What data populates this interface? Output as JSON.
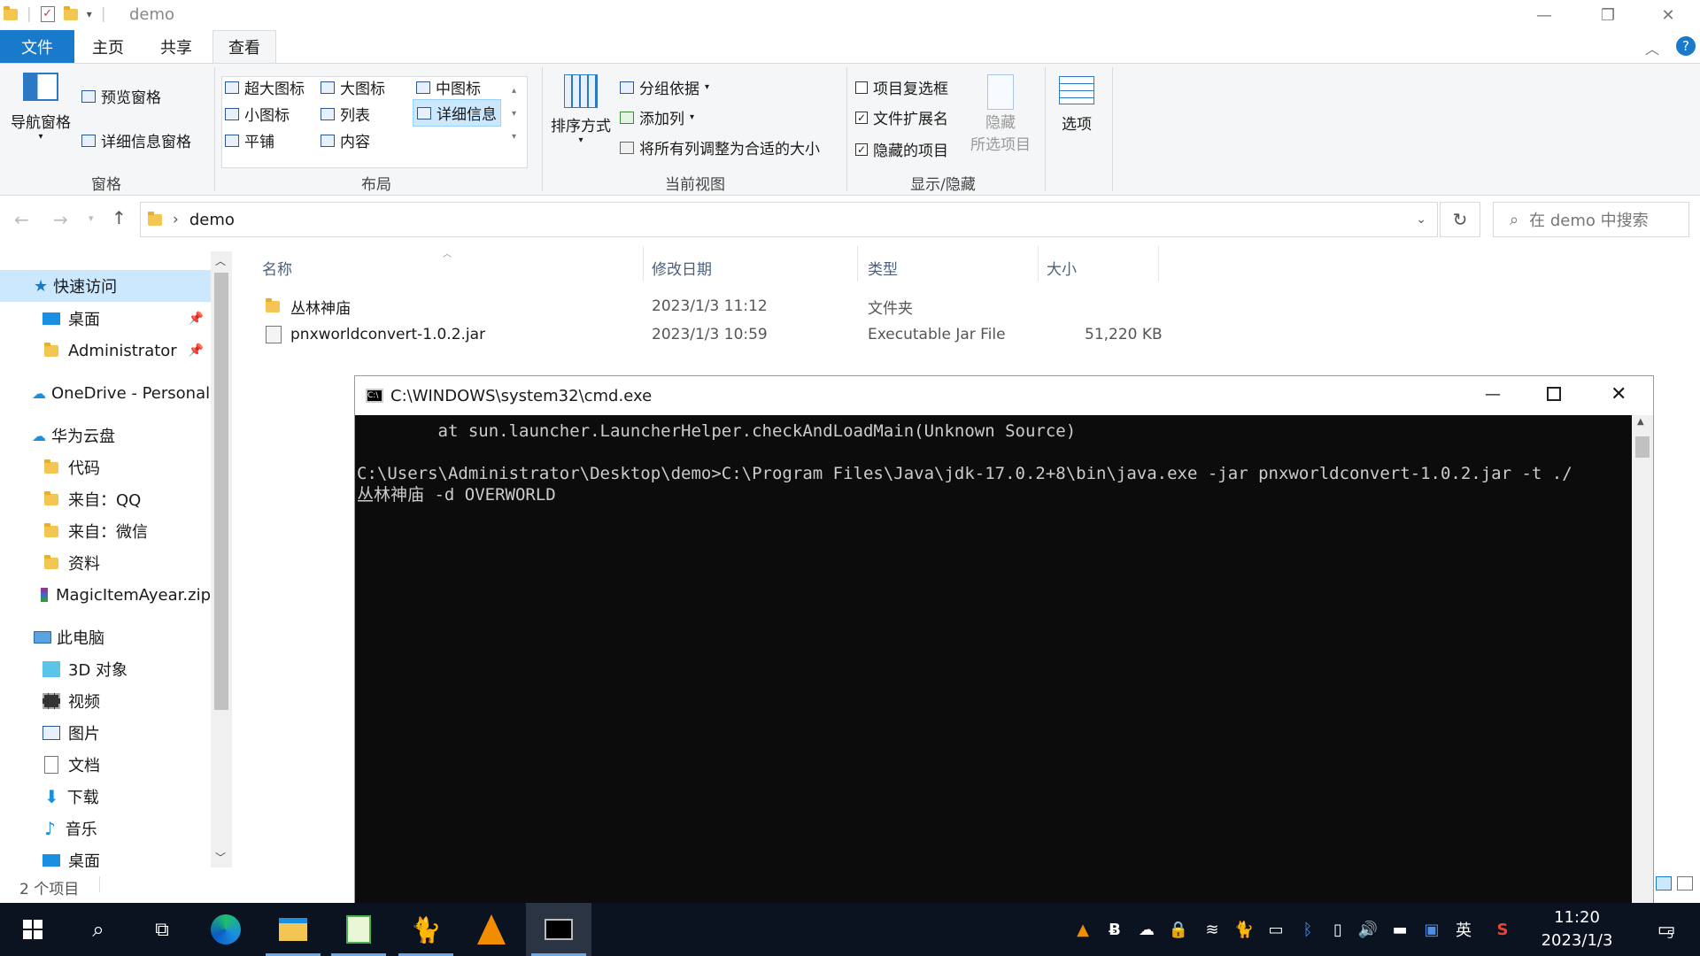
{
  "window": {
    "title": "demo"
  },
  "menu": {
    "file": "文件",
    "home": "主页",
    "share": "共享",
    "view": "查看"
  },
  "ribbon": {
    "pane_group": {
      "nav_pane": "导航窗格",
      "preview_pane": "预览窗格",
      "details_pane": "详细信息窗格",
      "label": "窗格"
    },
    "layout_group": {
      "xlarge": "超大图标",
      "large": "大图标",
      "medium": "中图标",
      "small": "小图标",
      "list": "列表",
      "details": "详细信息",
      "tiles": "平铺",
      "content": "内容",
      "label": "布局"
    },
    "view_group": {
      "sort": "排序方式",
      "group_by": "分组依据",
      "add_col": "添加列",
      "fit_cols": "将所有列调整为合适的大小",
      "label": "当前视图"
    },
    "showhide_group": {
      "item_checkboxes": "项目复选框",
      "file_ext": "文件扩展名",
      "hidden_items": "隐藏的项目",
      "hide_sel_1": "隐藏",
      "hide_sel_2": "所选项目",
      "label": "显示/隐藏"
    },
    "options": "选项",
    "checkboxes": {
      "item_checkboxes": false,
      "file_ext": true,
      "hidden_items": true
    }
  },
  "address": {
    "path": "demo",
    "search_placeholder": "在 demo 中搜索"
  },
  "nav": {
    "quick_access": "快速访问",
    "desktop_pinned": "桌面",
    "admin": "Administrator",
    "onedrive": "OneDrive - Personal",
    "huawei": "华为云盘",
    "code": "代码",
    "from_qq": "来自：QQ",
    "from_wechat": "来自：微信",
    "data": "资料",
    "magic": "MagicItemAyear.zip",
    "this_pc": "此电脑",
    "obj3d": "3D 对象",
    "video": "视频",
    "pictures": "图片",
    "documents": "文档",
    "downloads": "下载",
    "music": "音乐",
    "desktop": "桌面"
  },
  "columns": {
    "name": "名称",
    "modified": "修改日期",
    "type": "类型",
    "size": "大小"
  },
  "files": [
    {
      "name": "丛林神庙",
      "modified": "2023/1/3 11:12",
      "type": "文件夹",
      "size": ""
    },
    {
      "name": "pnxworldconvert-1.0.2.jar",
      "modified": "2023/1/3 10:59",
      "type": "Executable Jar File",
      "size": "51,220 KB"
    }
  ],
  "status": {
    "count": "2 个项目"
  },
  "cmd": {
    "title": "C:\\WINDOWS\\system32\\cmd.exe",
    "line1": "        at sun.launcher.LauncherHelper.checkAndLoadMain(Unknown Source)",
    "line2": "",
    "line3": "C:\\Users\\Administrator\\Desktop\\demo>C:\\Program Files\\Java\\jdk-17.0.2+8\\bin\\java.exe -jar pnxworldconvert-1.0.2.jar -t ./",
    "line4": "丛林神庙 -d OVERWORLD"
  },
  "taskbar": {
    "time": "11:20",
    "date": "2023/1/3",
    "ime": "英",
    "notifications": "5"
  },
  "colors": {
    "accent": "#1979ca",
    "selection": "#cce8ff",
    "taskbar": "#0b1220"
  }
}
